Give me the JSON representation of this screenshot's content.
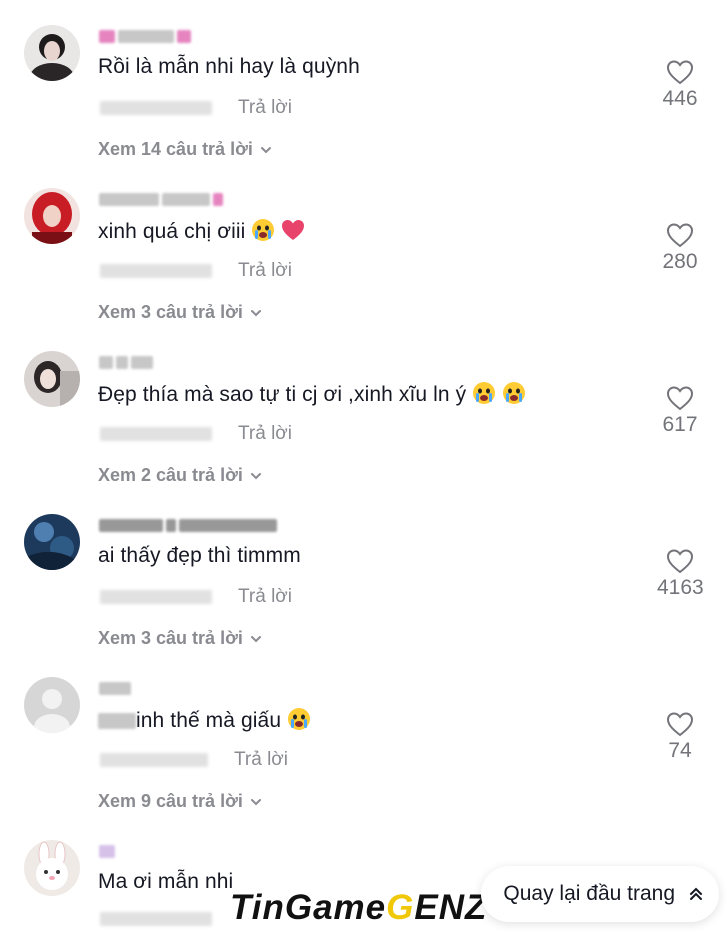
{
  "comments": [
    {
      "text": "Rồi là mẫn nhi hay là quỳnh",
      "reply": "Trả lời",
      "likes": "446",
      "view_replies": "Xem 14 câu trả lời",
      "emojis": []
    },
    {
      "text": "xinh quá chị ơiii",
      "reply": "Trả lời",
      "likes": "280",
      "view_replies": "Xem 3 câu trả lời",
      "emojis": [
        "crying-face",
        "heart"
      ]
    },
    {
      "text": "Đẹp thía mà sao tự ti cj ơi ,xinh xĩu ln ý",
      "reply": "Trả lời",
      "likes": "617",
      "view_replies": "Xem 2 câu trả lời",
      "emojis": [
        "crying-face",
        "crying-face"
      ]
    },
    {
      "text": "ai thấy đẹp thì timmm",
      "reply": "Trả lời",
      "likes": "4163",
      "view_replies": "Xem 3 câu trả lời",
      "emojis": []
    },
    {
      "text": "inh thế mà giấu",
      "reply": "Trả lời",
      "likes": "74",
      "view_replies": "Xem 9 câu trả lời",
      "emojis": [
        "crying-face"
      ]
    },
    {
      "text": "Ma ơi mẫn nhi",
      "reply": "Trả lời",
      "likes": "",
      "view_replies": "",
      "emojis": []
    }
  ],
  "back_to_top": {
    "label": "Quay lại đầu trang",
    "icon": "double-chevron-up-icon"
  },
  "watermark": {
    "part1": "TinGame",
    "part2": "G",
    "part3": "ENZ"
  },
  "colors": {
    "muted": "#8a8b91",
    "text": "#161823",
    "pink": "#e066b0"
  }
}
